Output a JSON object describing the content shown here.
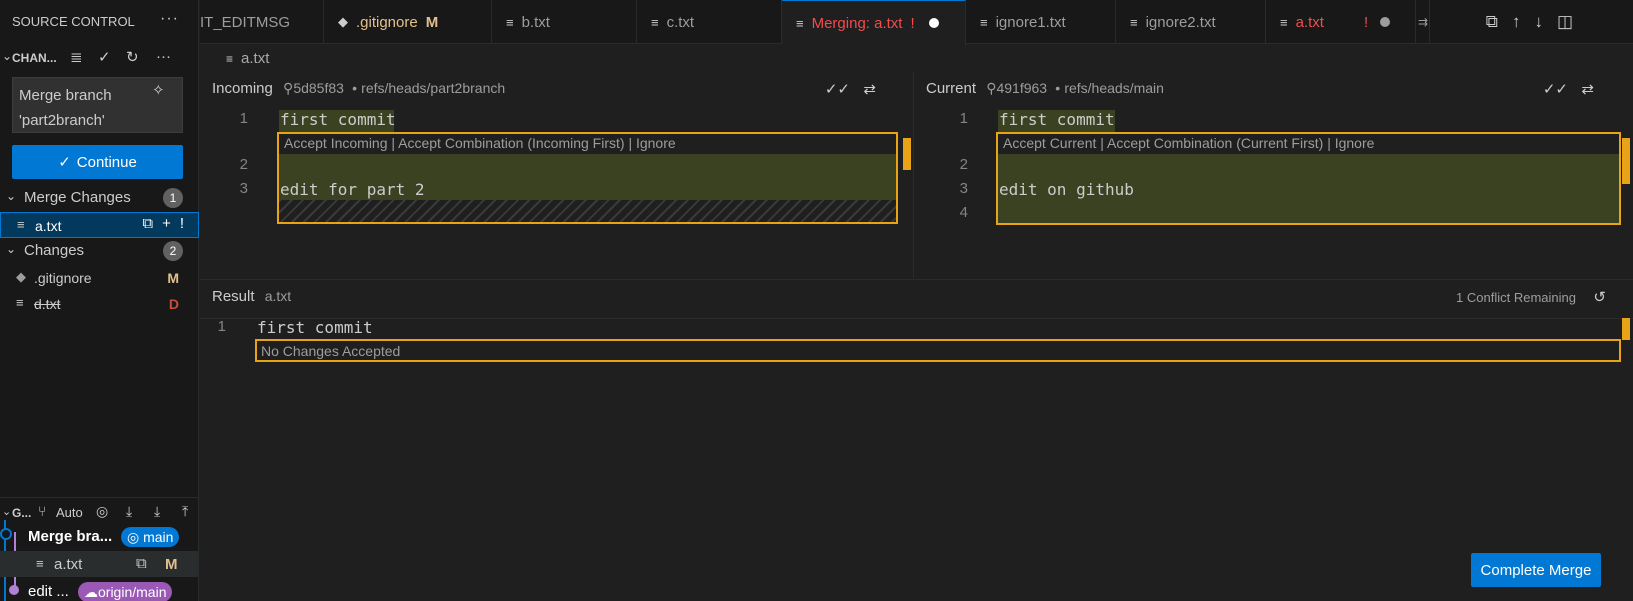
{
  "sidebar": {
    "title": "SOURCE CONTROL",
    "changes_section": "CHAN...",
    "commit_message": "Merge branch 'part2branch'",
    "continue_label": "Continue",
    "merge_changes": {
      "label": "Merge Changes",
      "count": "1"
    },
    "merge_files": [
      {
        "name": "a.txt",
        "badge": "!"
      }
    ],
    "changes": {
      "label": "Changes",
      "count": "2"
    },
    "change_files": [
      {
        "name": ".gitignore",
        "badge": "M"
      },
      {
        "name": "d.txt",
        "badge": "D"
      }
    ],
    "graph": {
      "label": "G...",
      "auto_label": "Auto",
      "items": [
        {
          "text": "Merge bra...",
          "ref": "main"
        },
        {
          "text": "a.txt",
          "badge": "M"
        },
        {
          "text": "edit ...",
          "ref": "origin/main"
        }
      ]
    }
  },
  "tabs": [
    {
      "label": "IT_EDITMSG"
    },
    {
      "label": ".gitignore",
      "badge": "M"
    },
    {
      "label": "b.txt"
    },
    {
      "label": "c.txt"
    },
    {
      "label": "Merging: a.txt",
      "badge": "!"
    },
    {
      "label": "ignore1.txt"
    },
    {
      "label": "ignore2.txt"
    },
    {
      "label": "a.txt",
      "badge": "!"
    }
  ],
  "breadcrumb": "a.txt",
  "incoming": {
    "title": "Incoming",
    "commit": "5d85f83",
    "ref": "refs/heads/part2branch",
    "code_lens": "Accept Incoming | Accept Combination (Incoming First) | Ignore",
    "lines": [
      {
        "num": "1",
        "text": "first commit"
      },
      {
        "num": "2",
        "text": ""
      },
      {
        "num": "3",
        "text": "edit for part 2"
      }
    ]
  },
  "current": {
    "title": "Current",
    "commit": "491f963",
    "ref": "refs/heads/main",
    "code_lens": "Accept Current | Accept Combination (Current First) | Ignore",
    "lines": [
      {
        "num": "1",
        "text": "first commit"
      },
      {
        "num": "2",
        "text": ""
      },
      {
        "num": "3",
        "text": "edit on github"
      },
      {
        "num": "4",
        "text": ""
      }
    ]
  },
  "result": {
    "title": "Result",
    "file": "a.txt",
    "status": "1 Conflict Remaining",
    "lines": [
      {
        "num": "1",
        "text": "first commit"
      }
    ],
    "placeholder": "No Changes Accepted"
  },
  "complete_merge_label": "Complete Merge",
  "colors": {
    "accent": "#0078d4",
    "conflict": "#e8a317",
    "error": "#f14c4c",
    "modified": "#e2c08d"
  }
}
